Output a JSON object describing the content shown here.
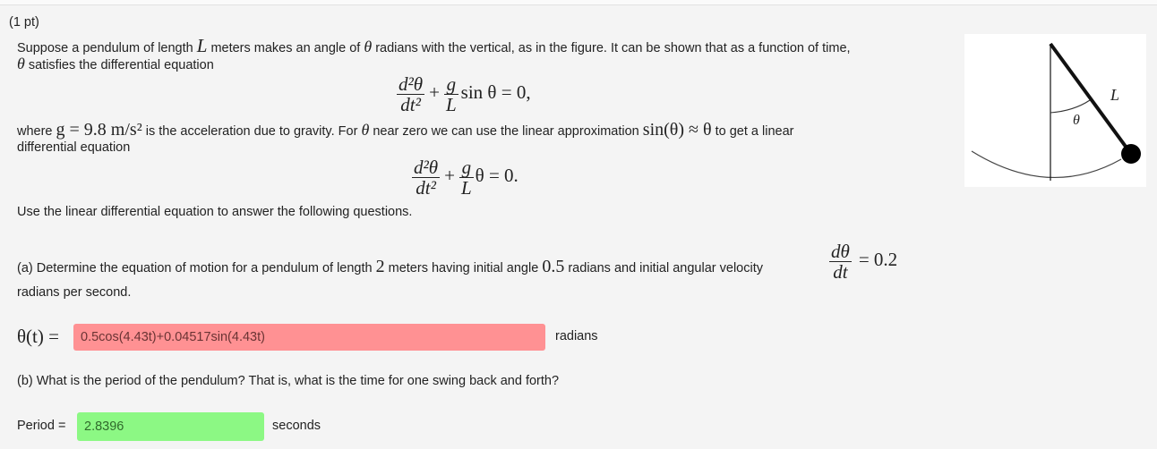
{
  "problem": {
    "points": "(1 pt)",
    "intro": {
      "p1": "Suppose a pendulum of length ",
      "var_L": "L",
      "p2": " meters makes an angle of ",
      "var_theta": "θ",
      "p3": " radians with the vertical, as in the figure. It can be shown that as a function of time,",
      "p4": " satisfies the differential equation"
    },
    "equation1": {
      "num": "d²θ",
      "den": "dt²",
      "plus": "+",
      "g": "g",
      "L": "L",
      "rest": "sin θ = 0,"
    },
    "where": {
      "p1": "where ",
      "g_expr": "g = 9.8 m/s²",
      "p2": " is the acceleration due to gravity. For ",
      "theta": "θ",
      "p3": " near zero we can use the linear approximation ",
      "approx": "sin(θ) ≈ θ",
      "p4": " to get a linear",
      "p5": "differential equation"
    },
    "equation2": {
      "num": "d²θ",
      "den": "dt²",
      "plus": "+",
      "g": "g",
      "L": "L",
      "rest": "θ = 0."
    },
    "instruction": "Use the linear differential equation to answer the following questions."
  },
  "part_a": {
    "p1": "(a) Determine the equation of motion for a pendulum of length ",
    "length": "2",
    "p2": " meters having initial angle ",
    "angle": "0.5",
    "p3": " radians and initial angular velocity ",
    "dnum": "dθ",
    "dden": "dt",
    "velocity": "= 0.2",
    "p4": "radians per second.",
    "label": "θ(t) =",
    "answer_value": "0.5cos(4.43t)+0.04517sin(4.43t)",
    "answer_status": "incorrect",
    "units": "radians"
  },
  "part_b": {
    "question": "(b) What is the period of the pendulum? That is, what is the time for one swing back and forth?",
    "label": "Period =",
    "answer_value": "2.8396",
    "answer_status": "correct",
    "units": "seconds"
  },
  "figure": {
    "label_L": "L",
    "label_theta": "θ"
  },
  "colors": {
    "incorrect": "#ff9193",
    "correct": "#8cf884",
    "background": "#f4f4f4"
  }
}
